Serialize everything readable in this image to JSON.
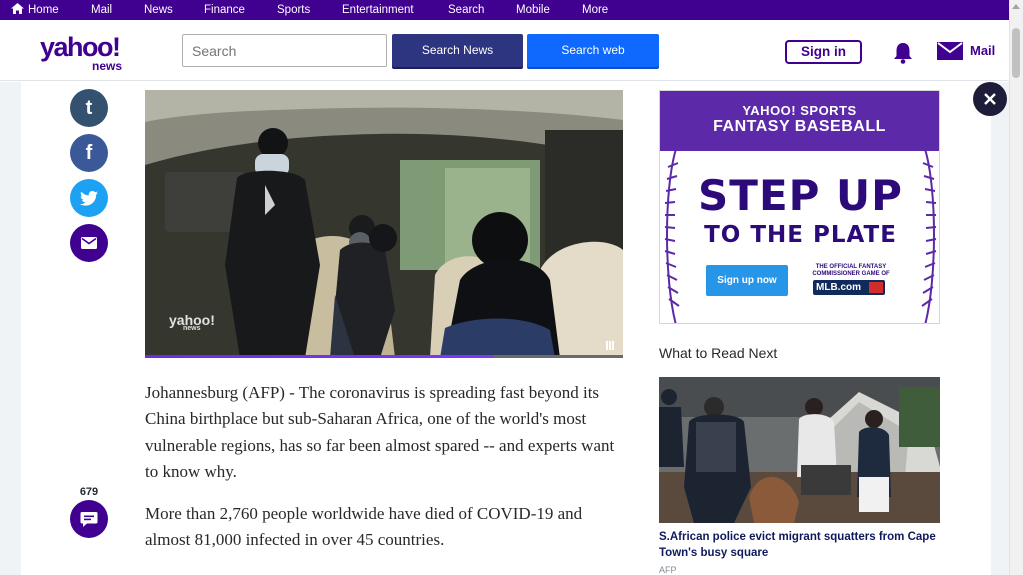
{
  "nav": {
    "items": [
      "Home",
      "Mail",
      "News",
      "Finance",
      "Sports",
      "Entertainment",
      "Search",
      "Mobile",
      "More"
    ]
  },
  "header": {
    "logo_text": "yahoo!",
    "logo_sub": "news",
    "search_placeholder": "Search",
    "search_news_label": "Search News",
    "search_web_label": "Search web",
    "signin_label": "Sign in",
    "mail_label": "Mail"
  },
  "social": {
    "tumblr_glyph": "t",
    "facebook_glyph": "f",
    "comment_count": "679"
  },
  "video": {
    "watermark": "yahoo!",
    "watermark_sub": "news",
    "progress_fraction": 0.73
  },
  "article": {
    "paragraphs": [
      "Johannesburg (AFP) - The coronavirus is spreading fast beyond its China birthplace but sub-Saharan Africa, one of the world's most vulnerable regions, has so far been almost spared -- and experts want to know why.",
      "More than 2,760 people worldwide have died of COVID-19 and almost 81,000 infected in over 45 countries."
    ]
  },
  "ad": {
    "brand": "YAHOO! SPORTS",
    "product": "FANTASY BASEBALL",
    "headline1": "STEP UP",
    "headline2": "TO THE PLATE",
    "cta": "Sign up now",
    "fine_print": "THE OFFICIAL FANTASY COMMISSIONER GAME OF",
    "partner": "MLB.com"
  },
  "read_next": {
    "heading": "What to Read Next",
    "title": "S.African police evict migrant squatters from Cape Town's busy square",
    "source": "AFP"
  },
  "colors": {
    "brand_purple": "#400090",
    "search_news_bg": "#2d3480",
    "search_web_bg": "#0f69ff"
  }
}
